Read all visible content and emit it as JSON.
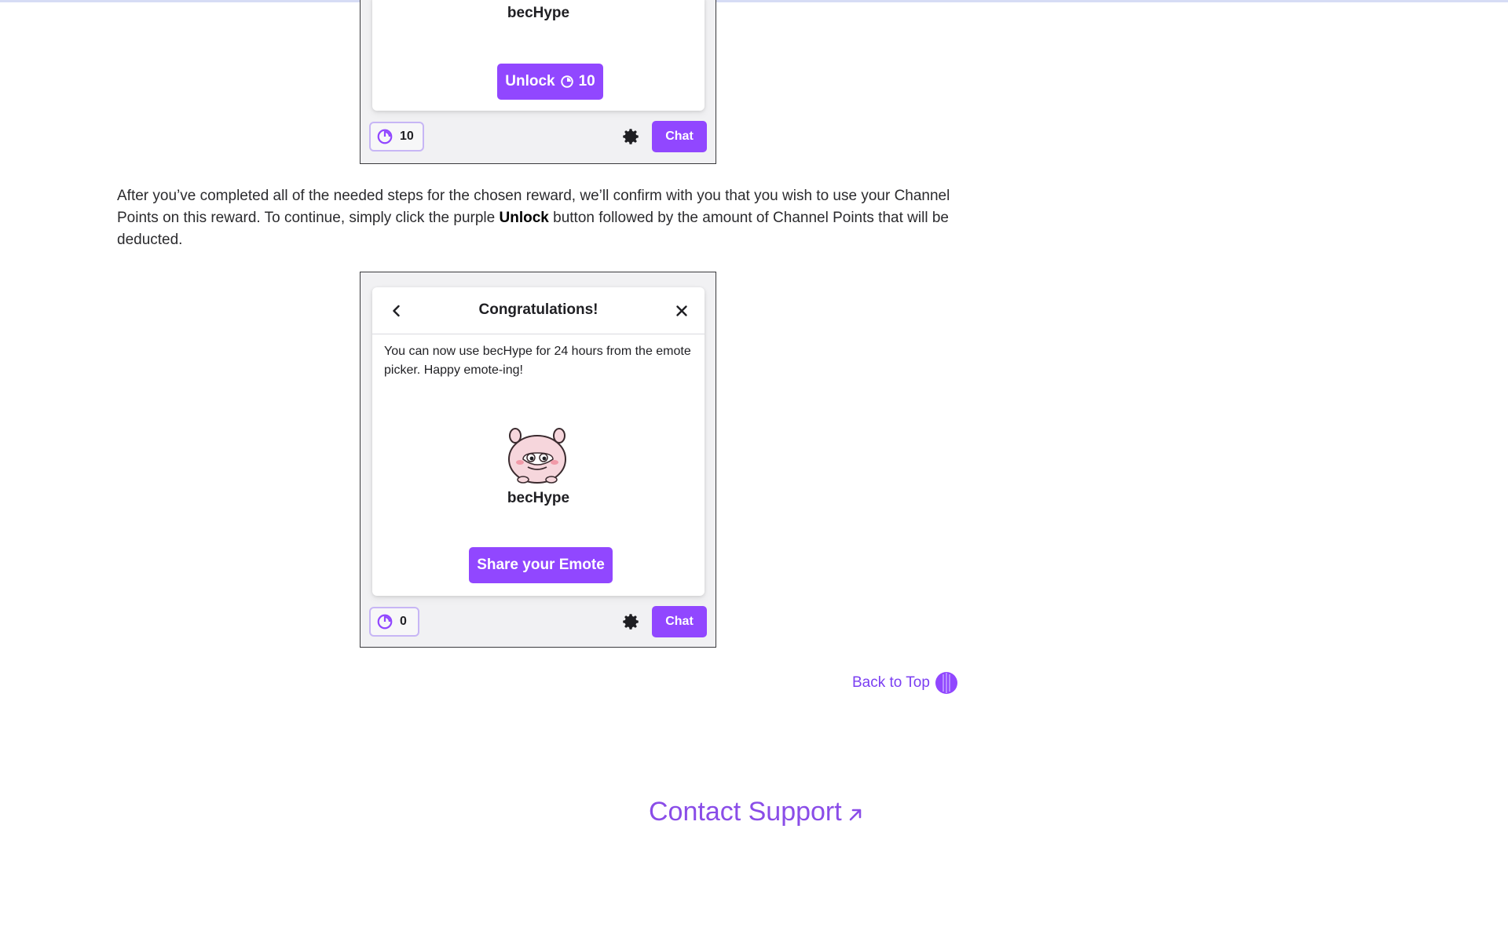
{
  "screenshot_top": {
    "emote_name": "becHype",
    "unlock_button": {
      "label": "Unlock",
      "cost": "10"
    },
    "points_balance": "10",
    "chat_button": "Chat"
  },
  "paragraph": {
    "part1": "After you’ve completed all of the needed steps for the chosen reward, we’ll confirm with you that you wish to use your Channel Points on this reward. To continue, simply click the purple ",
    "strong": "Unlock",
    "part2": " button followed by the amount of Channel Points that will be deducted."
  },
  "screenshot_bottom": {
    "title": "Congratulations!",
    "message": "You can now use becHype for 24 hours from the emote picker. Happy emote-ing!",
    "emote_name": "becHype",
    "share_button": "Share your Emote",
    "points_balance": "0",
    "chat_button": "Chat"
  },
  "back_to_top": "Back to Top",
  "contact_support": "Contact Support",
  "colors": {
    "accent": "#9147ff",
    "link": "#7b3ff2"
  },
  "icons": [
    "channel-points-icon",
    "gear-icon",
    "back-chevron-icon",
    "close-icon",
    "back-to-top-icon",
    "external-arrow-icon"
  ]
}
